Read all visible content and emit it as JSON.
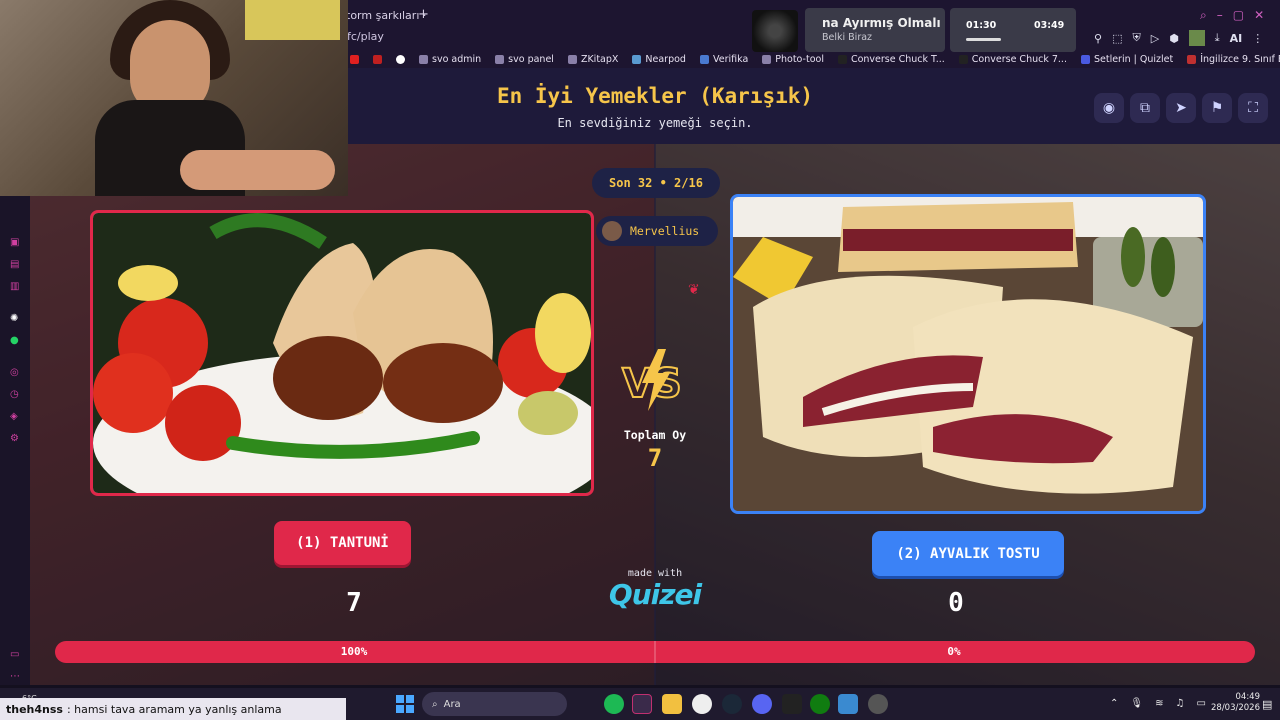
{
  "browser": {
    "tab_title": "torm şarkıları ·",
    "url": "8fc/play",
    "bookmarks": [
      "svo admin",
      "svo panel",
      "ZKitapX",
      "Nearpod",
      "Verifika",
      "Photo-tool",
      "Converse Chuck T...",
      "Converse Chuck 7...",
      "Setlerin | Quizlet",
      "İngilizce 9. Sınıf Et..."
    ],
    "toolbar_ai": "AI"
  },
  "media": {
    "song_title": "na Ayırmış Olmalı",
    "artist": "Belki Biraz",
    "elapsed": "01:30",
    "duration": "03:49",
    "progress_fraction": 0.39
  },
  "quiz": {
    "title": "En İyi Yemekler (Karışık)",
    "subtitle": "En sevdiğiniz yemeği seçin.",
    "round": "Son 32 • 2/16",
    "player": "Mervellius",
    "total_label": "Toplam Oy",
    "total_votes": "7",
    "made_with": "made with",
    "brand": "Quizei",
    "header_buttons": [
      "eye-icon",
      "share-icon",
      "send-icon",
      "flag-icon",
      "fullscreen-icon"
    ],
    "left": {
      "label": "(1) TANTUNİ",
      "votes": "7",
      "percent": "100%",
      "color": "#e0284a"
    },
    "right": {
      "label": "(2) AYVALIK TOSTU",
      "votes": "0",
      "percent": "0%",
      "color": "#3b82f6"
    }
  },
  "stream_overlay": {
    "chat_user": "theh4nss",
    "chat_message": ": hamsi tava aramam ya yanlış anlama",
    "weather": "6°C"
  },
  "taskbar": {
    "search_placeholder": "Ara",
    "time": "04:49",
    "date": "28/03/2026"
  }
}
